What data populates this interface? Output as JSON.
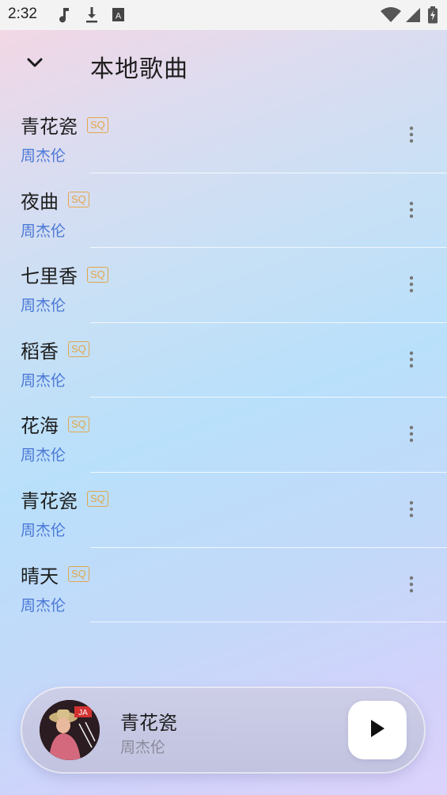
{
  "status_bar": {
    "time": "2:32",
    "icons": [
      "music-note-icon",
      "download-icon",
      "text-a-icon",
      "wifi-icon",
      "signal-icon",
      "battery-icon"
    ]
  },
  "header": {
    "title": "本地歌曲",
    "back_icon": "chevron-down-icon"
  },
  "songs": [
    {
      "title": "青花瓷",
      "badge": "SQ",
      "artist": "周杰伦"
    },
    {
      "title": "夜曲",
      "badge": "SQ",
      "artist": "周杰伦"
    },
    {
      "title": "七里香",
      "badge": "SQ",
      "artist": "周杰伦"
    },
    {
      "title": "稻香",
      "badge": "SQ",
      "artist": "周杰伦"
    },
    {
      "title": "花海",
      "badge": "SQ",
      "artist": "周杰伦"
    },
    {
      "title": "青花瓷",
      "badge": "SQ",
      "artist": "周杰伦"
    },
    {
      "title": "晴天",
      "badge": "SQ",
      "artist": "周杰伦"
    }
  ],
  "player": {
    "title": "青花瓷",
    "artist": "周杰伦",
    "play_icon": "play-icon"
  },
  "colors": {
    "artist_link": "#4b78d6",
    "badge": "#e3a64a",
    "title_text": "#1e1e1e"
  }
}
